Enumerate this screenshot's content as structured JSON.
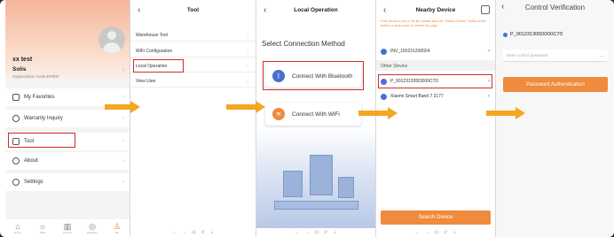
{
  "panel_profile": {
    "user": "xx  test",
    "org_name": "Solis",
    "org_code": "Organization Code:EPIEIF",
    "menu": [
      {
        "label": "My Favorites",
        "icon": "favorites-icon"
      },
      {
        "label": "Warranty Inquiry",
        "icon": "warranty-icon"
      },
      {
        "label": "Tool",
        "icon": "tool-icon"
      },
      {
        "label": "About",
        "icon": "about-icon"
      },
      {
        "label": "Settings",
        "icon": "settings-icon"
      }
    ],
    "tabs": [
      {
        "label": "Home",
        "icon": "home-icon"
      },
      {
        "label": "Plant",
        "icon": "plant-icon"
      },
      {
        "label": "Device",
        "icon": "device-icon"
      },
      {
        "label": "Discover",
        "icon": "discover-icon"
      },
      {
        "label": "Me",
        "icon": "me-icon"
      }
    ]
  },
  "panel_tool": {
    "title": "Tool",
    "items": [
      "Warehouse Tool",
      "WiFi Configuration",
      "Local Operation",
      "View User"
    ]
  },
  "panel_local": {
    "title": "Local Operation",
    "heading": "Select Connection Method",
    "bluetooth_label": "Connect With Bluetooth",
    "wifi_label": "Connect With WiFi"
  },
  "panel_nearby": {
    "title": "Nearby Device",
    "hint": "If the device is not in the list, please click the \"Search Device\" button at the bottom or drop down to refresh the page",
    "recent_device": "INV_150231200024",
    "section_label": "Other Device",
    "devices": [
      "P_901231305DD00C7D",
      "Xiaomi Smart Band 7 2177"
    ],
    "search_button": "Search Device"
  },
  "panel_verify": {
    "title": "Control Verification",
    "device": "P_901231305DD00C7D",
    "password_placeholder": "Enter control password",
    "auth_button": "Password Authentication"
  },
  "colors": {
    "accent": "#f08a3c",
    "arrow": "#f5a623",
    "highlight": "#d12b2b",
    "device_dot": "#4a6fd1"
  }
}
